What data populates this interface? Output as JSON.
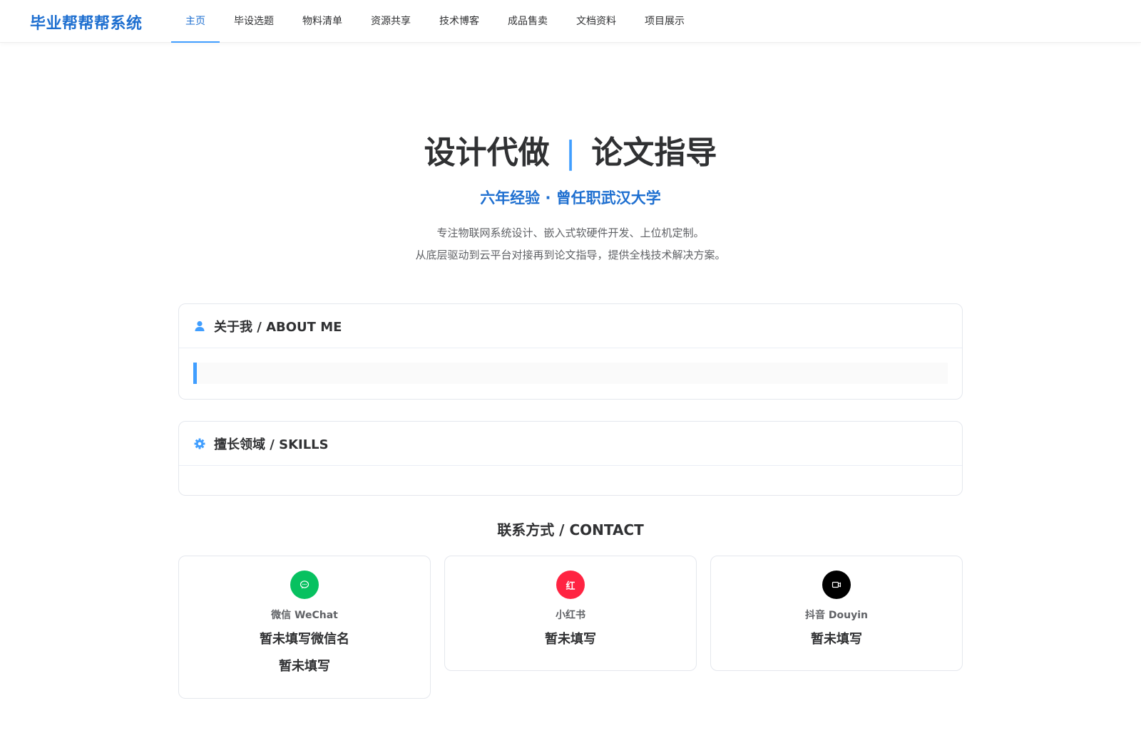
{
  "header": {
    "logo": "毕业帮帮帮系统",
    "nav": [
      {
        "label": "主页",
        "active": true
      },
      {
        "label": "毕设选题"
      },
      {
        "label": "物料清单"
      },
      {
        "label": "资源共享"
      },
      {
        "label": "技术博客"
      },
      {
        "label": "成品售卖"
      },
      {
        "label": "文档资料"
      },
      {
        "label": "项目展示"
      }
    ]
  },
  "hero": {
    "title_left": "设计代做",
    "separator": "|",
    "title_right": "论文指导",
    "subtitle": "六年经验 · 曾任职武汉大学",
    "desc_line1": "专注物联网系统设计、嵌入式软硬件开发、上位机定制。",
    "desc_line2": "从底层驱动到云平台对接再到论文指导，提供全栈技术解决方案。"
  },
  "about": {
    "title": "关于我 / ABOUT ME",
    "icon": "user-icon",
    "content": ""
  },
  "skills": {
    "title": "擅长领域 / SKILLS",
    "icon": "gear-icon"
  },
  "contact": {
    "title": "联系方式 / CONTACT",
    "wechat": {
      "icon": "wechat-icon",
      "label": "微信 WeChat",
      "name": "暂未填写微信名",
      "id": "暂未填写",
      "color": "#07c160"
    },
    "xiaohongshu": {
      "icon_text": "红",
      "label": "小红书",
      "value": "暂未填写",
      "color": "#ff2442"
    },
    "douyin": {
      "icon": "video-icon",
      "label": "抖音 Douyin",
      "value": "暂未填写",
      "color": "#000000"
    }
  },
  "colors": {
    "accent": "#409eff",
    "brand": "#1e6fd0"
  }
}
